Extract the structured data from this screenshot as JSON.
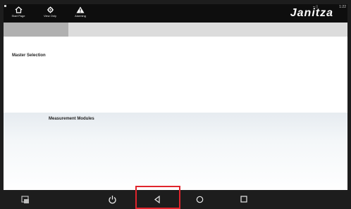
{
  "header": {
    "brand": "Janitza",
    "clock": "1:22",
    "signal": "⌁ ▯",
    "buttons": [
      {
        "label": "Start Page",
        "icon": "home-icon"
      },
      {
        "label": "View Only",
        "icon": "gear-icon"
      },
      {
        "label": "Alarming",
        "icon": "warning-icon"
      }
    ]
  },
  "main": {
    "master_title": "Master Selection",
    "modules_title": "Measurement Modules"
  },
  "navbar": {
    "icons": [
      "screenshot-icon",
      "power-icon",
      "back-icon",
      "home-circle-icon",
      "recents-icon"
    ]
  },
  "colors": {
    "highlight": "#e0242c",
    "header_bg": "#0e0e0e",
    "tab_active": "#b0b0b0"
  }
}
